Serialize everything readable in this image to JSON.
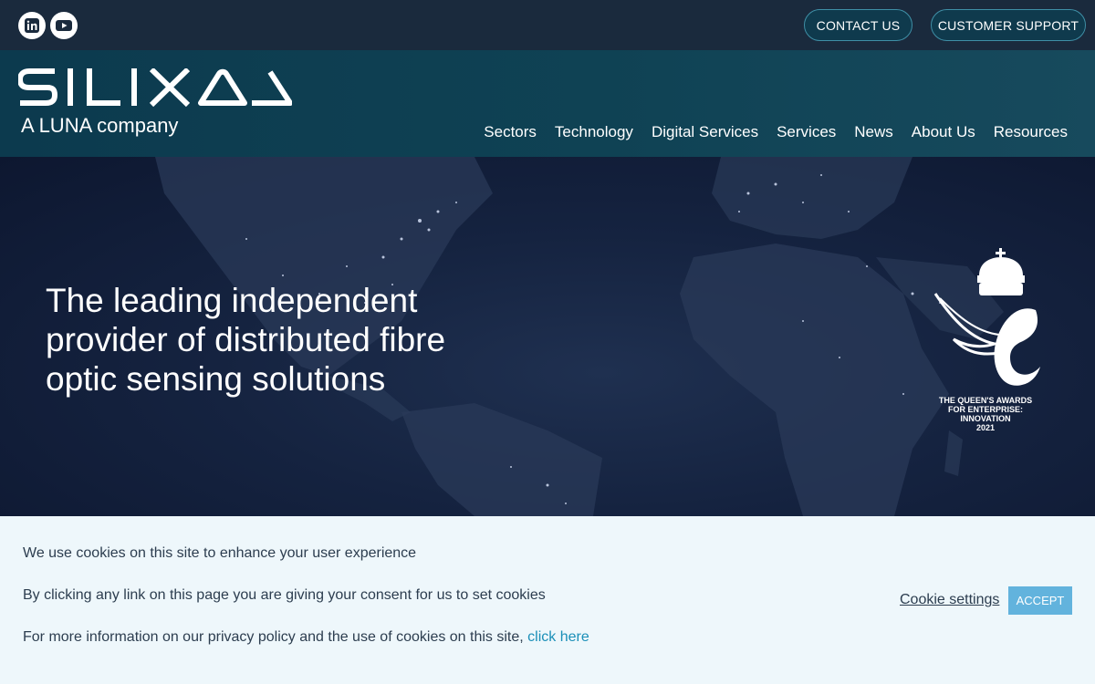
{
  "topbar": {
    "social": [
      {
        "icon": "linkedin-icon",
        "label": "in"
      },
      {
        "icon": "youtube-icon",
        "label": ""
      }
    ],
    "contact_label": "CONTACT US",
    "support_label": "CUSTOMER SUPPORT"
  },
  "header": {
    "logo_wordmark": "SILIXA",
    "logo_tagline": "A LUNA company",
    "nav": [
      "Sectors",
      "Technology",
      "Digital Services",
      "Services",
      "News",
      "About Us",
      "Resources"
    ]
  },
  "hero": {
    "title": "The leading independent provider of distributed fibre optic sensing solutions",
    "award": {
      "lines": [
        "THE QUEEN'S AWARDS",
        "FOR ENTERPRISE:",
        "INNOVATION",
        "2021"
      ]
    }
  },
  "cookie": {
    "line1": "We use cookies on this site to enhance your user experience",
    "line2": "By clicking any link on this page you are giving your consent for us to set cookies",
    "line3": "For more information on our privacy policy and the use of cookies on this site,",
    "link": "click here",
    "settings_label": "Cookie settings",
    "accept_label": "ACCEPT"
  },
  "colors": {
    "topbar_bg": "#1a2a3d",
    "header_bg": "#0f4254",
    "accent": "#62b3dd",
    "link": "#1a8fb8"
  }
}
